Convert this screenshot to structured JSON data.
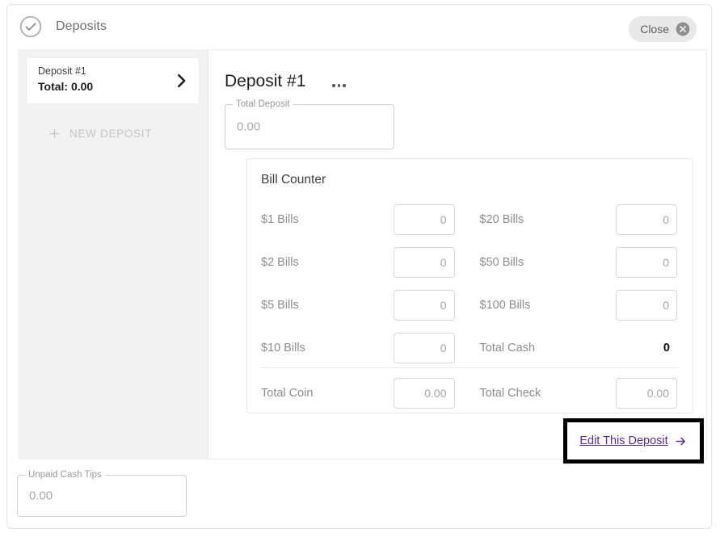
{
  "header": {
    "status_icon": "check-circle-icon",
    "title": "Deposits",
    "close_label": "Close",
    "close_icon": "close-circle-icon"
  },
  "sidebar": {
    "deposit_items": [
      {
        "name": "Deposit #1",
        "total_label": "Total: 0.00",
        "chevron_icon": "chevron-right-icon"
      }
    ],
    "new_deposit": {
      "label": "NEW DEPOSIT",
      "icon": "plus-icon"
    }
  },
  "main": {
    "title": "Deposit #1",
    "overflow_icon": "kebab-menu-icon",
    "total_deposit": {
      "label": "Total Deposit",
      "value": "0.00"
    },
    "bill_counter": {
      "title": "Bill Counter",
      "rows": [
        {
          "left": {
            "label": "$1 Bills",
            "value": "0",
            "type": "input"
          },
          "right": {
            "label": "$20 Bills",
            "value": "0",
            "type": "input"
          }
        },
        {
          "left": {
            "label": "$2 Bills",
            "value": "0",
            "type": "input"
          },
          "right": {
            "label": "$50 Bills",
            "value": "0",
            "type": "input"
          }
        },
        {
          "left": {
            "label": "$5 Bills",
            "value": "0",
            "type": "input"
          },
          "right": {
            "label": "$100 Bills",
            "value": "0",
            "type": "input"
          }
        },
        {
          "left": {
            "label": "$10 Bills",
            "value": "0",
            "type": "input"
          },
          "right": {
            "label": "Total Cash",
            "value": "0",
            "type": "readonly"
          }
        }
      ],
      "totals_row": {
        "left": {
          "label": "Total Coin",
          "value": "0.00",
          "type": "input"
        },
        "right": {
          "label": "Total Check",
          "value": "0.00",
          "type": "input"
        }
      }
    },
    "edit_link": {
      "label": "Edit This Deposit",
      "icon": "arrow-right-icon",
      "highlight_color": "#000000",
      "link_color": "#5b2a86"
    }
  },
  "footer": {
    "unpaid_cash_tips": {
      "label": "Unpaid Cash Tips",
      "value": "0.00"
    }
  }
}
